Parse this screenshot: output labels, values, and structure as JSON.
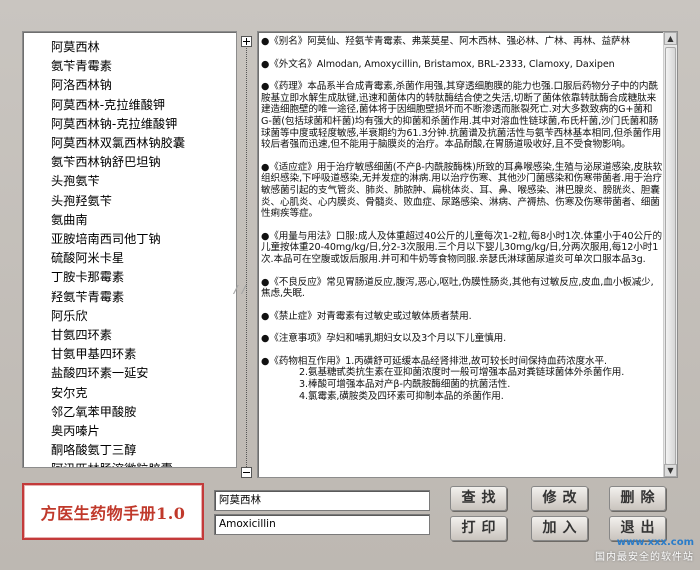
{
  "drug_list": [
    "阿莫西林",
    "氨苄青霉素",
    "阿洛西林钠",
    "阿莫西林-克拉维酸钾",
    "阿莫西林钠-克拉维酸钾",
    "阿莫西林双氯西林钠胶囊",
    "氨苄西林钠舒巴坦钠",
    "头孢氨苄",
    "头孢羟氨苄",
    "氨曲南",
    "亚胺培南西司他丁钠",
    "硫酸阿米卡星",
    "丁胺卡那霉素",
    "羟氨苄青霉素",
    "阿乐欣",
    "甘氨四环素",
    "甘氨甲基四环素",
    "盐酸四环素一延安",
    "安尔克",
    "邻乙氧苯甲酸胺",
    "奥丙嗪片",
    "酮咯酸氨丁三醇",
    "阿讯匹林肠溶微粒胶囊"
  ],
  "detail": {
    "p1": "●《别名》阿莫仙、羟氨苄青霉素、弗莱莫星、阿木西林、强必林、广林、再林、益萨林",
    "p2": "●《外文名》Almodan, Amoxycillin, Bristamox, BRL-2333, Clamoxy, Daxipen",
    "p3": "●《药理》本品系半合成青霉素,杀菌作用强,其穿透细胞膜的能力也强.口服后药物分子中的内酰胺基立即水解生成肽键,迅速和菌体内的转肽酶结合使之失活,切断了菌体依靠转肽酶合成糖肽来建造细胞壁的唯一途径,菌体将于因细胞壁损坏而不断渗透而胀裂死亡.对大多数致病的G+菌和G-菌(包括球菌和杆菌)均有强大的抑菌和杀菌作用.其中对溶血性链球菌,布氏杆菌,沙门氏菌和肠球菌等中度或轻度敏感,半衰期约为61.3分钟.抗菌谱及抗菌活性与氨苄西林基本相同,但杀菌作用较后者强而迅速,但不能用于脑膜炎的治疗。本品耐酸,在胃肠道吸收好,且不受食物影响。",
    "p4": "●《适应症》用于治疗敏感细菌(不产β-内酰胺酶株)所致的耳鼻喉感染,生殖与泌尿道感染,皮肤软组织感染,下呼吸道感染,无并发症的淋病.用以治疗伤寒、其他沙门菌感染和伤寒带菌者.用于治疗敏感菌引起的支气管炎、肺炎、肺脓肿、扁桃体炎、耳、鼻、喉感染、淋巴腺炎、膀胱炎、胆囊炎、心肌炎、心内膜炎、骨髓炎、败血症、尿路感染、淋病、产褥热、伤寒及伤寒带菌者、细菌性痢疾等症。",
    "p5": "●《用量与用法》口服:成人及体重超过40公斤的儿童每次1-2粒,每8小时1次.体重小于40公斤的儿童按体重20-40mg/kg/日,分2-3次服用.三个月以下婴儿30mg/kg/日,分两次服用,每12小时1次.本品可在空腹或饭后服用.并可和牛奶等食物同服.亲瑟氏淋球菌尿道炎可单次口服本品3g.",
    "p6": "●《不良反应》常见胃肠道反应,腹泻,恶心,呕吐,伪膜性肠炎,其他有过敏反应,皮血,血小板减少,焦虑,失眠.",
    "p7": "●《禁止症》对青霉素有过敏史或过敏体质者禁用.",
    "p8": "●《注意事项》孕妇和哺乳期妇女以及3个月以下儿童慎用.",
    "p9_head": "●《药物相互作用》1.丙磺舒可延缓本品经肾排泄,故可较长时间保持血药浓度水平.",
    "p9_l2": "2.氨基糖甙类抗生素在亚抑菌浓度时一般可增强本品对粪链球菌体外杀菌作用.",
    "p9_l3": "3.棒酸可增强本品对产β-内酰胺酶细菌的抗菌活性.",
    "p9_l4": "4.氯霉素,磺胺类及四环素可抑制本品的杀菌作用."
  },
  "brand_title": "方医生药物手册1.0",
  "search_cn_value": "阿莫西林",
  "search_en_value": "Amoxicillin",
  "buttons": {
    "search": "查找",
    "edit": "修改",
    "delete": "删除",
    "print": "打印",
    "add": "加入",
    "exit": "退出"
  },
  "watermark": {
    "site": "www.xxx.com",
    "slogan": "国内最安全的软件站"
  },
  "colors": {
    "background": "#bdb8b2",
    "brand_text": "#c0392b",
    "brand_border": "#c33a3a"
  },
  "icons": {
    "tree_box_top": "plus-box",
    "tree_box_bottom": "minus-box",
    "scroll_up": "up-arrow",
    "scroll_down": "down-arrow"
  }
}
